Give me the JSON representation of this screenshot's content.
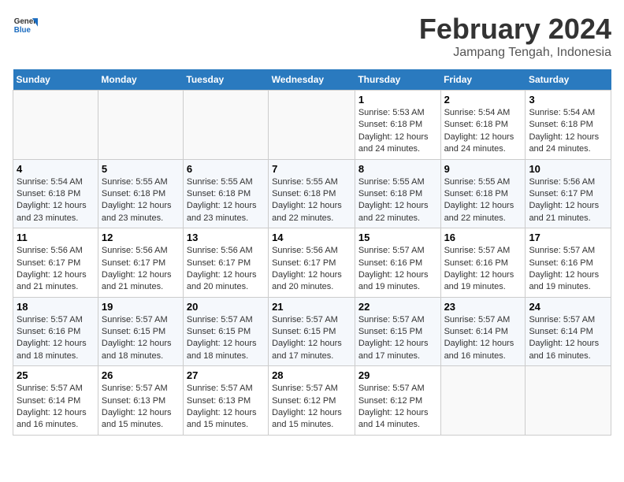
{
  "header": {
    "logo_line1": "General",
    "logo_line2": "Blue",
    "title": "February 2024",
    "subtitle": "Jampang Tengah, Indonesia"
  },
  "days_of_week": [
    "Sunday",
    "Monday",
    "Tuesday",
    "Wednesday",
    "Thursday",
    "Friday",
    "Saturday"
  ],
  "weeks": [
    [
      {
        "day": "",
        "info": ""
      },
      {
        "day": "",
        "info": ""
      },
      {
        "day": "",
        "info": ""
      },
      {
        "day": "",
        "info": ""
      },
      {
        "day": "1",
        "info": "Sunrise: 5:53 AM\nSunset: 6:18 PM\nDaylight: 12 hours and 24 minutes."
      },
      {
        "day": "2",
        "info": "Sunrise: 5:54 AM\nSunset: 6:18 PM\nDaylight: 12 hours and 24 minutes."
      },
      {
        "day": "3",
        "info": "Sunrise: 5:54 AM\nSunset: 6:18 PM\nDaylight: 12 hours and 24 minutes."
      }
    ],
    [
      {
        "day": "4",
        "info": "Sunrise: 5:54 AM\nSunset: 6:18 PM\nDaylight: 12 hours and 23 minutes."
      },
      {
        "day": "5",
        "info": "Sunrise: 5:55 AM\nSunset: 6:18 PM\nDaylight: 12 hours and 23 minutes."
      },
      {
        "day": "6",
        "info": "Sunrise: 5:55 AM\nSunset: 6:18 PM\nDaylight: 12 hours and 23 minutes."
      },
      {
        "day": "7",
        "info": "Sunrise: 5:55 AM\nSunset: 6:18 PM\nDaylight: 12 hours and 22 minutes."
      },
      {
        "day": "8",
        "info": "Sunrise: 5:55 AM\nSunset: 6:18 PM\nDaylight: 12 hours and 22 minutes."
      },
      {
        "day": "9",
        "info": "Sunrise: 5:55 AM\nSunset: 6:18 PM\nDaylight: 12 hours and 22 minutes."
      },
      {
        "day": "10",
        "info": "Sunrise: 5:56 AM\nSunset: 6:17 PM\nDaylight: 12 hours and 21 minutes."
      }
    ],
    [
      {
        "day": "11",
        "info": "Sunrise: 5:56 AM\nSunset: 6:17 PM\nDaylight: 12 hours and 21 minutes."
      },
      {
        "day": "12",
        "info": "Sunrise: 5:56 AM\nSunset: 6:17 PM\nDaylight: 12 hours and 21 minutes."
      },
      {
        "day": "13",
        "info": "Sunrise: 5:56 AM\nSunset: 6:17 PM\nDaylight: 12 hours and 20 minutes."
      },
      {
        "day": "14",
        "info": "Sunrise: 5:56 AM\nSunset: 6:17 PM\nDaylight: 12 hours and 20 minutes."
      },
      {
        "day": "15",
        "info": "Sunrise: 5:57 AM\nSunset: 6:16 PM\nDaylight: 12 hours and 19 minutes."
      },
      {
        "day": "16",
        "info": "Sunrise: 5:57 AM\nSunset: 6:16 PM\nDaylight: 12 hours and 19 minutes."
      },
      {
        "day": "17",
        "info": "Sunrise: 5:57 AM\nSunset: 6:16 PM\nDaylight: 12 hours and 19 minutes."
      }
    ],
    [
      {
        "day": "18",
        "info": "Sunrise: 5:57 AM\nSunset: 6:16 PM\nDaylight: 12 hours and 18 minutes."
      },
      {
        "day": "19",
        "info": "Sunrise: 5:57 AM\nSunset: 6:15 PM\nDaylight: 12 hours and 18 minutes."
      },
      {
        "day": "20",
        "info": "Sunrise: 5:57 AM\nSunset: 6:15 PM\nDaylight: 12 hours and 18 minutes."
      },
      {
        "day": "21",
        "info": "Sunrise: 5:57 AM\nSunset: 6:15 PM\nDaylight: 12 hours and 17 minutes."
      },
      {
        "day": "22",
        "info": "Sunrise: 5:57 AM\nSunset: 6:15 PM\nDaylight: 12 hours and 17 minutes."
      },
      {
        "day": "23",
        "info": "Sunrise: 5:57 AM\nSunset: 6:14 PM\nDaylight: 12 hours and 16 minutes."
      },
      {
        "day": "24",
        "info": "Sunrise: 5:57 AM\nSunset: 6:14 PM\nDaylight: 12 hours and 16 minutes."
      }
    ],
    [
      {
        "day": "25",
        "info": "Sunrise: 5:57 AM\nSunset: 6:14 PM\nDaylight: 12 hours and 16 minutes."
      },
      {
        "day": "26",
        "info": "Sunrise: 5:57 AM\nSunset: 6:13 PM\nDaylight: 12 hours and 15 minutes."
      },
      {
        "day": "27",
        "info": "Sunrise: 5:57 AM\nSunset: 6:13 PM\nDaylight: 12 hours and 15 minutes."
      },
      {
        "day": "28",
        "info": "Sunrise: 5:57 AM\nSunset: 6:12 PM\nDaylight: 12 hours and 15 minutes."
      },
      {
        "day": "29",
        "info": "Sunrise: 5:57 AM\nSunset: 6:12 PM\nDaylight: 12 hours and 14 minutes."
      },
      {
        "day": "",
        "info": ""
      },
      {
        "day": "",
        "info": ""
      }
    ]
  ]
}
